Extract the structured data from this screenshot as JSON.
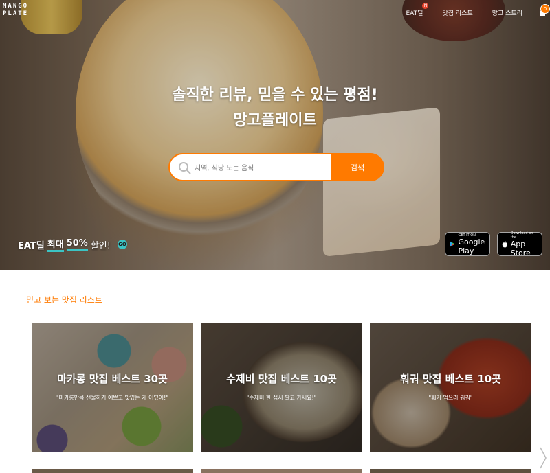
{
  "brand": {
    "logo_line1": "MANGO",
    "logo_line2": "PLATE"
  },
  "nav": {
    "items": [
      {
        "label": "EAT딜",
        "badge": "N"
      },
      {
        "label": "맛집 리스트"
      },
      {
        "label": "망고 스토리"
      }
    ],
    "profile_badge": "0"
  },
  "hero": {
    "headline1": "솔직한 리뷰, 믿을 수 있는 평점!",
    "headline2": "망고플레이트",
    "search_placeholder": "지역, 식당 또는 음식",
    "search_button": "검색"
  },
  "promo": {
    "eat": "EAT딜",
    "mid": "최대",
    "highlight": "50%",
    "tail": "할인!",
    "go": "GO"
  },
  "stores": {
    "google_small": "GET IT ON",
    "google_big": "Google Play",
    "apple_small": "Download on the",
    "apple_big": "App Store"
  },
  "section": {
    "title": "믿고 보는 맛집 리스트",
    "cards": [
      {
        "title": "마카롱 맛집 베스트 30곳",
        "subtitle": "\"마카롱만큼 선물하기 예쁘고 맛있는 게 어딨어!\""
      },
      {
        "title": "수제비 맛집 베스트 10곳",
        "subtitle": "\"수제비 한 접시 팔고 가세요!\""
      },
      {
        "title": "훠궈 맛집 베스트 10곳",
        "subtitle": "\"훠거 먹으러 궈궈\""
      }
    ]
  },
  "colors": {
    "accent": "#ff7a00",
    "teal": "#3bc4c4"
  }
}
